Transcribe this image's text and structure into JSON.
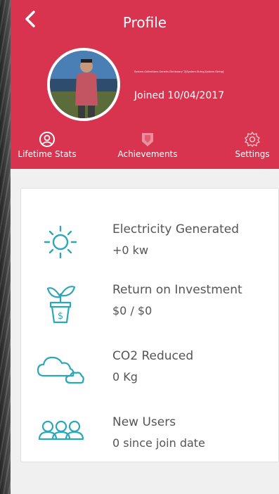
{
  "header": {
    "title": "Profile",
    "back_icon": "chevron-left-icon",
    "tiny_text": "System.Collections.Generic.Dictionary`2[System.String,System.String]",
    "joined": "Joined 10/04/2017",
    "color": "#d9344f"
  },
  "tabs": [
    {
      "label": "Lifetime Stats",
      "icon": "user-circle-icon"
    },
    {
      "label": "Achievements",
      "icon": "shield-icon"
    },
    {
      "label": "Settings",
      "icon": "gear-icon"
    }
  ],
  "stats": [
    {
      "label": "Electricity Generated",
      "value": "+0 kw",
      "icon": "sun-icon"
    },
    {
      "label": "Return on Investment",
      "value": "$0 / $0",
      "icon": "plant-money-icon"
    },
    {
      "label": "CO2 Reduced",
      "value": "0 Kg",
      "icon": "cloud-icon"
    },
    {
      "label": "New Users",
      "value": "0 since join date",
      "icon": "users-icon"
    }
  ],
  "accent_color": "#2aa7b8"
}
